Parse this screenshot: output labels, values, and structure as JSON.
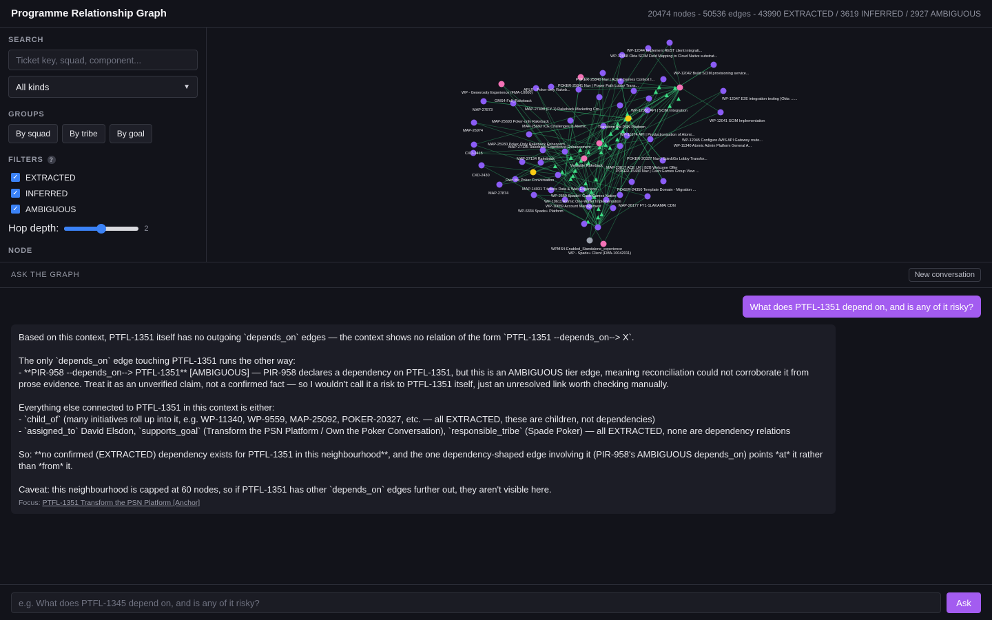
{
  "app": {
    "title": "Programme Relationship Graph",
    "stats": "20474 nodes - 50536 edges - 43990 EXTRACTED / 3619 INFERRED / 2927 AMBIGUOUS"
  },
  "sidebar": {
    "search": {
      "label": "SEARCH",
      "placeholder": "Ticket key, squad, component..."
    },
    "kind_select": {
      "value": "All kinds"
    },
    "groups": {
      "label": "GROUPS",
      "buttons": [
        "By squad",
        "By tribe",
        "By goal"
      ]
    },
    "filters": {
      "label": "FILTERS",
      "help_icon": "?",
      "items": [
        {
          "label": "EXTRACTED",
          "checked": true
        },
        {
          "label": "INFERRED",
          "checked": true
        },
        {
          "label": "AMBIGUOUS",
          "checked": true
        }
      ]
    },
    "hop_depth": {
      "label": "Hop depth:",
      "value": "2",
      "level": 0.5
    },
    "node_label": "NODE"
  },
  "graph": {
    "colors": {
      "edge": "#3ddc84",
      "node_purple": "#8b5cf6",
      "node_pink": "#f472b6",
      "node_yellow": "#facc15",
      "node_gray": "#9ca3af"
    },
    "labels": [
      "WP-12044 Implement REST client integrati...",
      "WP-12058 Okta SCIM Field Mapping to Cloud Native substrat...",
      "WP-12042 Build SCIM provisioning service...",
      "POKER-25840 Nav | Active Games Context I...",
      "POKER-25841 Nav | Power Path Lobby Trans...",
      "WP - Generosity Experience (FMA-10000)",
      "APLR - Poker-only Rakeb...",
      "WP-12047 E2E integration testing (Okta →...",
      "GMS4-Full_Rakeback",
      "MAP-27873",
      "MAP-27498 (FY-1) Rakeback Marketing Cro...",
      "WP-12051 API | SCIM Integration",
      "WP-12041 SCIM Implementation",
      "MAP-25693 Poker-only Rakeback",
      "MAP-25692 ICE Challenges in Atomic",
      "Transform the PSN Platform",
      "MAP-26974",
      "WP-11674 API | Productionisation of Atomi...",
      "WP-12045 Configure AWS API Gateway route...",
      "MAP-25930 Poker-Only Rakeback Enhancem...",
      "MAP-27135 Rakeback Experience Enhancement",
      "WP-11340 Atomic Admin Platform General A...",
      "CXD-2415",
      "POKER-20327 Nav | Spin&Go Lobby Transfor...",
      "MAP-27134 Rakeback",
      "Versatile Rakeback",
      "MAP-23817 ACE UK | B2B Welcome Offer",
      "POKER-15430 Nav | Cash Games Group View ...",
      "CXD-2430",
      "Own the Poker Conversation",
      "MAP-14031 T-tickets Data & Web Experienc...",
      "POKER-24350 Template Domain - Migration ...",
      "MAP-27874",
      "WP-2559 Spade+ Cash Games Native",
      "WP-10611 Atomic One-Wallet Implementation",
      "WP-10659 Account Management",
      "MAP-26177 FY1-1LAKAMAI CDN",
      "WP-6334 Spade+ Platform",
      "WPMS4-Enabled_Standalone_experience",
      "WP - Spade+ Client (FMA-10042011)"
    ]
  },
  "chat": {
    "header": "ASK THE GRAPH",
    "new_conversation": "New conversation",
    "user_question": "What does PTFL-1351 depend on, and is any of it risky?",
    "answer": {
      "p1": "Based on this context, PTFL-1351 itself has no outgoing `depends_on` edges — the context shows no relation of the form `PTFL-1351 --depends_on--> X`.",
      "p2_line1": "The only `depends_on` edge touching PTFL-1351 runs the other way:",
      "p2_line2": "- **PIR-958 --depends_on--> PTFL-1351** [AMBIGUOUS] — PIR-958 declares a dependency on PTFL-1351, but this is an AMBIGUOUS tier edge, meaning reconciliation could not corroborate it from prose evidence. Treat it as an unverified claim, not a confirmed fact — so I wouldn't call it a risk to PTFL-1351 itself, just an unresolved link worth checking manually.",
      "p3_line1": "Everything else connected to PTFL-1351 in this context is either:",
      "p3_line2": "- `child_of` (many initiatives roll up into it, e.g. WP-11340, WP-9559, MAP-25092, POKER-20327, etc. — all EXTRACTED, these are children, not dependencies)",
      "p3_line3": "- `assigned_to` David Elsdon, `supports_goal` (Transform the PSN Platform / Own the Poker Conversation), `responsible_tribe` (Spade Poker) — all EXTRACTED, none are dependency relations",
      "p4": "So: **no confirmed (EXTRACTED) dependency exists for PTFL-1351 in this neighbourhood**, and the one dependency-shaped edge involving it (PIR-958's AMBIGUOUS depends_on) points *at* it rather than *from* it.",
      "p5": "Caveat: this neighbourhood is capped at 60 nodes, so if PTFL-1351 has other `depends_on` edges further out, they aren't visible here.",
      "focus_label": "Focus:",
      "focus_link": "PTFL-1351 Transform the PSN Platform [Anchor]"
    },
    "input_placeholder": "e.g. What does PTFL-1345 depend on, and is any of it risky?",
    "ask_button": "Ask"
  }
}
